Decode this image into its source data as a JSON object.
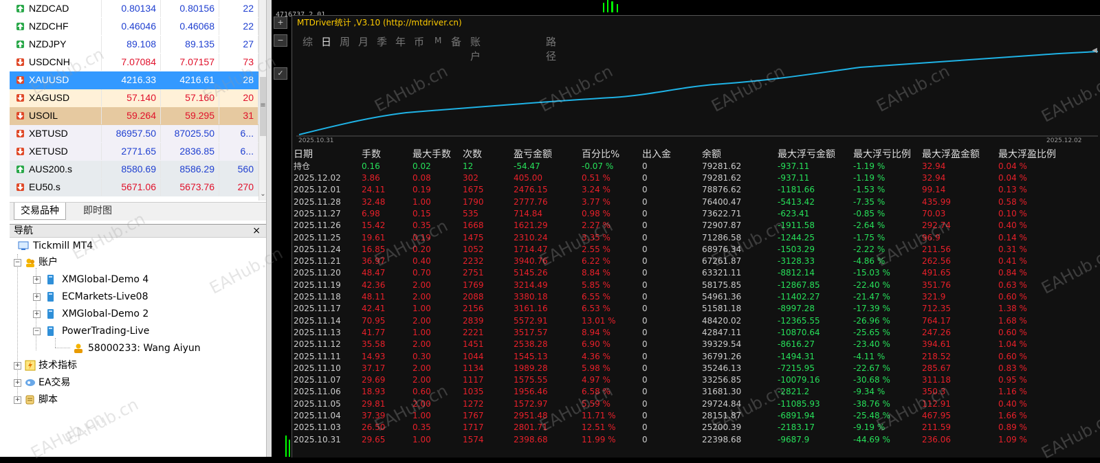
{
  "market_watch": {
    "rows": [
      {
        "symbol": "NZDCAD",
        "bid": "0.80134",
        "ask": "0.80156",
        "spread": "22",
        "dir": "up",
        "bg": "#ffffff",
        "color": "#1f3fd0"
      },
      {
        "symbol": "NZDCHF",
        "bid": "0.46046",
        "ask": "0.46068",
        "spread": "22",
        "dir": "up",
        "bg": "#ffffff",
        "color": "#1f3fd0"
      },
      {
        "symbol": "NZDJPY",
        "bid": "89.108",
        "ask": "89.135",
        "spread": "27",
        "dir": "up",
        "bg": "#ffffff",
        "color": "#1f3fd0"
      },
      {
        "symbol": "USDCNH",
        "bid": "7.07084",
        "ask": "7.07157",
        "spread": "73",
        "dir": "down",
        "bg": "#ffffff",
        "color": "#e0102a"
      },
      {
        "symbol": "XAUUSD",
        "bid": "4216.33",
        "ask": "4216.61",
        "spread": "28",
        "dir": "down",
        "bg": "#3399ff",
        "color": "#ffffff",
        "selected": true
      },
      {
        "symbol": "XAGUSD",
        "bid": "57.140",
        "ask": "57.160",
        "spread": "20",
        "dir": "down",
        "bg": "#fff1d8",
        "color": "#e0102a"
      },
      {
        "symbol": "USOIL",
        "bid": "59.264",
        "ask": "59.295",
        "spread": "31",
        "dir": "down",
        "bg": "#e6c9a0",
        "color": "#e0102a"
      },
      {
        "symbol": "XBTUSD",
        "bid": "86957.50",
        "ask": "87025.50",
        "spread": "6...",
        "dir": "down",
        "bg": "#f2f0f7",
        "color": "#1f3fd0"
      },
      {
        "symbol": "XETUSD",
        "bid": "2771.65",
        "ask": "2836.85",
        "spread": "6...",
        "dir": "down",
        "bg": "#f2f0f7",
        "color": "#1f3fd0"
      },
      {
        "symbol": "AUS200.s",
        "bid": "8580.69",
        "ask": "8586.29",
        "spread": "560",
        "dir": "up",
        "bg": "#e7ebee",
        "color": "#1f3fd0"
      },
      {
        "symbol": "EU50.s",
        "bid": "5671.06",
        "ask": "5673.76",
        "spread": "270",
        "dir": "down",
        "bg": "#e7ebee",
        "color": "#e0102a"
      }
    ],
    "tabs": [
      "交易品种",
      "即时图"
    ]
  },
  "navigator": {
    "title": "导航",
    "close": "×",
    "root": "Tickmill MT4",
    "accounts_label": "账户",
    "accounts": [
      "XMGlobal-Demo 4",
      "ECMarkets-Live08",
      "XMGlobal-Demo 2",
      "PowerTrading-Live"
    ],
    "account_child": "58000233: Wang Aiyun",
    "indicators": "技术指标",
    "experts": "EA交易",
    "scripts": "脚本"
  },
  "chart_top_text": "4716737     2.01",
  "stats_panel": {
    "title": "MTDriver统计 ,V3.10 (http://mtdriver.cn)",
    "toolbar": [
      "综",
      "日",
      "周",
      "月",
      "季",
      "年",
      "币",
      "M",
      "备",
      "账户",
      "路径"
    ],
    "active_tab": "日",
    "date_start": "2025.10.31",
    "date_end": "2025.12.02",
    "headers": [
      "日期",
      "手数",
      "最大手数",
      "次数",
      "盈亏金额",
      "百分比%",
      "出入金",
      "余额",
      "最大浮亏金额",
      "最大浮亏比例",
      "最大浮盈金额",
      "最大浮盈比例"
    ],
    "position_row": [
      "持仓",
      "0.16",
      "0.02",
      "12",
      "-54.47",
      "-0.07 %",
      "0",
      "79281.62",
      "-937.11",
      "-1.19 %",
      "32.94",
      "0.04 %"
    ],
    "rows": [
      [
        "2025.12.02",
        "3.86",
        "0.08",
        "302",
        "405.00",
        "0.51 %",
        "0",
        "79281.62",
        "-937.11",
        "-1.19 %",
        "32.94",
        "0.04 %"
      ],
      [
        "2025.12.01",
        "24.11",
        "0.19",
        "1675",
        "2476.15",
        "3.24 %",
        "0",
        "78876.62",
        "-1181.66",
        "-1.53 %",
        "99.14",
        "0.13 %"
      ],
      [
        "2025.11.28",
        "32.48",
        "1.00",
        "1790",
        "2777.76",
        "3.77 %",
        "0",
        "76400.47",
        "-5413.42",
        "-7.35 %",
        "435.99",
        "0.58 %"
      ],
      [
        "2025.11.27",
        "6.98",
        "0.15",
        "535",
        "714.84",
        "0.98 %",
        "0",
        "73622.71",
        "-623.41",
        "-0.85 %",
        "70.03",
        "0.10 %"
      ],
      [
        "2025.11.26",
        "15.42",
        "0.35",
        "1668",
        "1621.29",
        "2.27 %",
        "0",
        "72907.87",
        "-1911.58",
        "-2.64 %",
        "292.74",
        "0.40 %"
      ],
      [
        "2025.11.25",
        "19.61",
        "0.19",
        "1475",
        "2310.24",
        "3.35 %",
        "0",
        "71286.58",
        "-1244.25",
        "-1.75 %",
        "96.9",
        "0.14 %"
      ],
      [
        "2025.11.24",
        "16.85",
        "0.20",
        "1052",
        "1714.47",
        "2.55 %",
        "0",
        "68976.34",
        "-1503.29",
        "-2.22 %",
        "211.56",
        "0.31 %"
      ],
      [
        "2025.11.21",
        "36.97",
        "0.40",
        "2232",
        "3940.76",
        "6.22 %",
        "0",
        "67261.87",
        "-3128.33",
        "-4.86 %",
        "262.56",
        "0.41 %"
      ],
      [
        "2025.11.20",
        "48.47",
        "0.70",
        "2751",
        "5145.26",
        "8.84 %",
        "0",
        "63321.11",
        "-8812.14",
        "-15.03 %",
        "491.65",
        "0.84 %"
      ],
      [
        "2025.11.19",
        "42.36",
        "2.00",
        "1769",
        "3214.49",
        "5.85 %",
        "0",
        "58175.85",
        "-12867.85",
        "-22.40 %",
        "351.76",
        "0.63 %"
      ],
      [
        "2025.11.18",
        "48.11",
        "2.00",
        "2088",
        "3380.18",
        "6.55 %",
        "0",
        "54961.36",
        "-11402.27",
        "-21.47 %",
        "321.9",
        "0.60 %"
      ],
      [
        "2025.11.17",
        "42.41",
        "1.00",
        "2156",
        "3161.16",
        "6.53 %",
        "0",
        "51581.18",
        "-8997.28",
        "-17.39 %",
        "712.35",
        "1.38 %"
      ],
      [
        "2025.11.14",
        "70.95",
        "2.00",
        "2839",
        "5572.91",
        "13.01 %",
        "0",
        "48420.02",
        "-12365.55",
        "-26.96 %",
        "764.17",
        "1.68 %"
      ],
      [
        "2025.11.13",
        "41.77",
        "1.00",
        "2221",
        "3517.57",
        "8.94 %",
        "0",
        "42847.11",
        "-10870.64",
        "-25.65 %",
        "247.26",
        "0.60 %"
      ],
      [
        "2025.11.12",
        "35.58",
        "2.00",
        "1451",
        "2538.28",
        "6.90 %",
        "0",
        "39329.54",
        "-8616.27",
        "-23.40 %",
        "394.61",
        "1.04 %"
      ],
      [
        "2025.11.11",
        "14.93",
        "0.30",
        "1044",
        "1545.13",
        "4.36 %",
        "0",
        "36791.26",
        "-1494.31",
        "-4.11 %",
        "218.52",
        "0.60 %"
      ],
      [
        "2025.11.10",
        "37.17",
        "2.00",
        "1134",
        "1989.28",
        "5.98 %",
        "0",
        "35246.13",
        "-7215.95",
        "-22.67 %",
        "285.67",
        "0.83 %"
      ],
      [
        "2025.11.07",
        "29.69",
        "2.00",
        "1117",
        "1575.55",
        "4.97 %",
        "0",
        "33256.85",
        "-10079.16",
        "-30.68 %",
        "311.18",
        "0.95 %"
      ],
      [
        "2025.11.06",
        "18.93",
        "0.60",
        "1035",
        "1956.46",
        "6.58 %",
        "0",
        "31681.30",
        "-2821.2",
        "-9.34 %",
        "350.3",
        "1.16 %"
      ],
      [
        "2025.11.05",
        "29.81",
        "2.00",
        "1272",
        "1572.97",
        "5.59 %",
        "0",
        "29724.84",
        "-11085.93",
        "-38.76 %",
        "112.91",
        "0.40 %"
      ],
      [
        "2025.11.04",
        "37.39",
        "1.00",
        "1767",
        "2951.48",
        "11.71 %",
        "0",
        "28151.87",
        "-6891.94",
        "-25.48 %",
        "467.95",
        "1.66 %"
      ],
      [
        "2025.11.03",
        "26.50",
        "0.35",
        "1717",
        "2801.71",
        "12.51 %",
        "0",
        "25200.39",
        "-2183.17",
        "-9.19 %",
        "211.59",
        "0.89 %"
      ],
      [
        "2025.10.31",
        "29.65",
        "1.00",
        "1574",
        "2398.68",
        "11.99 %",
        "0",
        "22398.68",
        "-9687.9",
        "-44.69 %",
        "236.06",
        "1.09 %"
      ]
    ]
  },
  "colors": {
    "accent_blue": "#3399ff",
    "profit_red": "#e8202a",
    "loss_green": "#27e05a",
    "curve": "#1fb3e6",
    "title_yellow": "#ffcc00"
  },
  "watermark": "EAHub.cn",
  "icons": [
    "arrow-up-icon",
    "arrow-down-icon",
    "folder-icon",
    "account-icon",
    "server-icon",
    "user-icon",
    "indicator-icon",
    "expert-icon",
    "script-icon",
    "close-icon",
    "scroll-down-icon"
  ]
}
